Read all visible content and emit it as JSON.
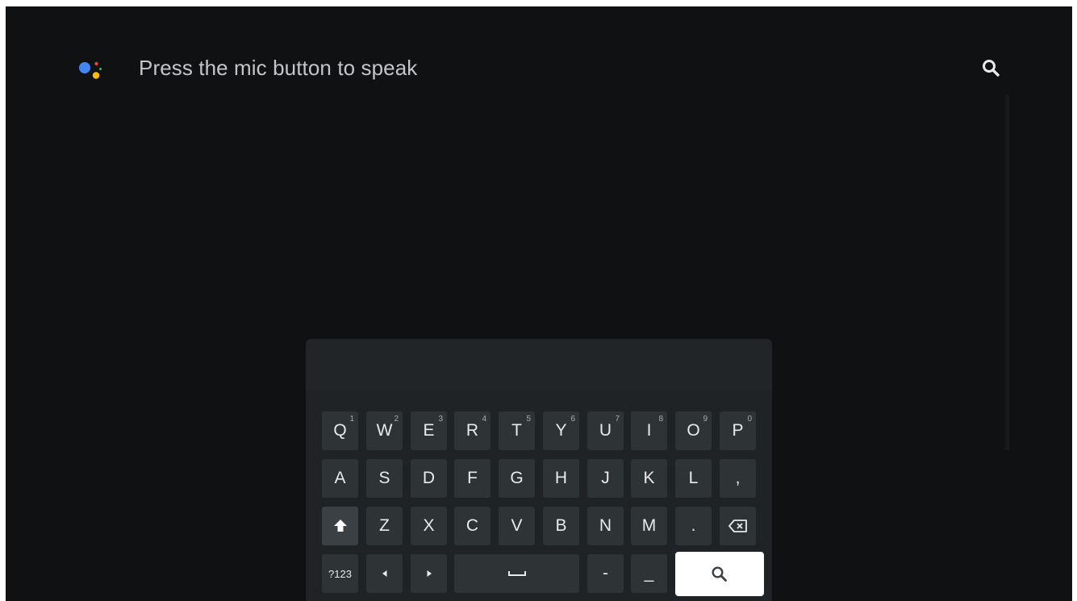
{
  "search": {
    "prompt": "Press the mic button to speak",
    "assistant_icon": "google-assistant-icon",
    "search_icon": "search-icon"
  },
  "keyboard": {
    "row1": [
      {
        "label": "Q",
        "hint": "1"
      },
      {
        "label": "W",
        "hint": "2"
      },
      {
        "label": "E",
        "hint": "3"
      },
      {
        "label": "R",
        "hint": "4"
      },
      {
        "label": "T",
        "hint": "5"
      },
      {
        "label": "Y",
        "hint": "6"
      },
      {
        "label": "U",
        "hint": "7"
      },
      {
        "label": "I",
        "hint": "8"
      },
      {
        "label": "O",
        "hint": "9"
      },
      {
        "label": "P",
        "hint": "0"
      }
    ],
    "row2": [
      "A",
      "S",
      "D",
      "F",
      "G",
      "H",
      "J",
      "K",
      "L",
      ","
    ],
    "row3": {
      "shift_icon": "shift-icon",
      "letters": [
        "Z",
        "X",
        "C",
        "V",
        "B",
        "N",
        "M",
        "."
      ],
      "backspace_icon": "backspace-icon"
    },
    "row4": {
      "symbols_label": "?123",
      "left_icon": "arrow-left-icon",
      "right_icon": "arrow-right-icon",
      "space_icon": "space-icon",
      "dash": "-",
      "underscore": "_",
      "search_icon": "search-icon"
    }
  },
  "colors": {
    "background": "#0f1112",
    "keyboard": "#1f2326",
    "key": "#2e3336",
    "key_text": "#e8eaeb",
    "selected_key": "#ffffff",
    "assistant_blue": "#4285f4",
    "assistant_red": "#ea4335",
    "assistant_yellow": "#fbbc05",
    "assistant_green": "#34a853"
  }
}
